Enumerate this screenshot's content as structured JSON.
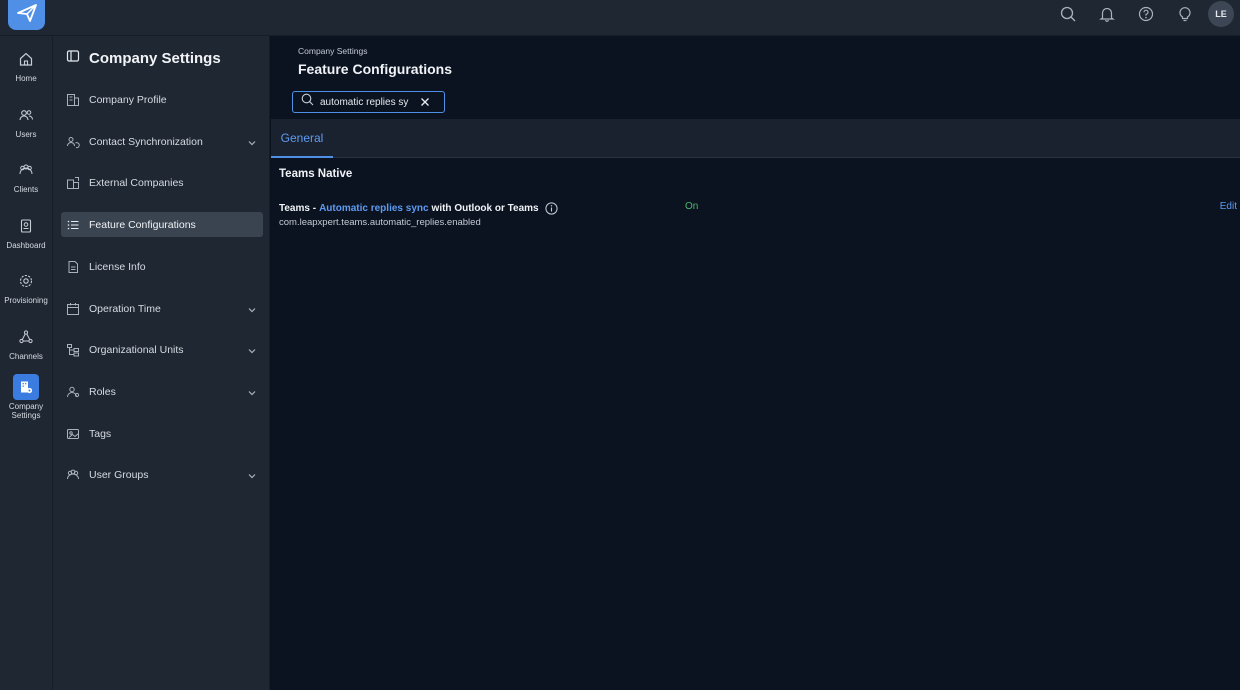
{
  "header": {
    "logo_icon": "paper-plane-icon",
    "icons": [
      "search-icon",
      "bell-icon",
      "help-icon",
      "lightbulb-icon"
    ],
    "avatar_initials": "LE"
  },
  "nav": {
    "items": [
      {
        "label": "Home",
        "icon": "home-icon"
      },
      {
        "label": "Users",
        "icon": "users-icon"
      },
      {
        "label": "Clients",
        "icon": "clients-icon"
      },
      {
        "label": "Dashboard",
        "icon": "dashboard-icon"
      },
      {
        "label": "Provisioning",
        "icon": "gear-icon"
      },
      {
        "label": "Channels",
        "icon": "channels-icon"
      },
      {
        "label": "Company Settings",
        "icon": "company-settings-icon"
      }
    ],
    "active": "Company Settings"
  },
  "sidepanel": {
    "title": "Company Settings",
    "items": [
      {
        "label": "Company Profile",
        "expandable": false
      },
      {
        "label": "Contact Synchronization",
        "expandable": true
      },
      {
        "label": "External Companies",
        "expandable": false
      },
      {
        "label": "Feature Configurations",
        "expandable": false,
        "active": true
      },
      {
        "label": "License Info",
        "expandable": false
      },
      {
        "label": "Operation Time",
        "expandable": true
      },
      {
        "label": "Organizational Units",
        "expandable": true
      },
      {
        "label": "Roles",
        "expandable": true
      },
      {
        "label": "Tags",
        "expandable": false
      },
      {
        "label": "User Groups",
        "expandable": true
      }
    ]
  },
  "main": {
    "breadcrumb": "Company Settings",
    "title": "Feature Configurations",
    "search_value": "automatic replies sy",
    "tabs": [
      {
        "label": "General",
        "active": true
      }
    ],
    "section": "Teams Native",
    "row": {
      "prefix": "Teams -",
      "highlight": "Automatic replies sync",
      "suffix": "with Outlook or Teams",
      "key": "com.leapxpert.teams.automatic_replies.enabled",
      "status": "On",
      "action": "Edit"
    }
  },
  "colors": {
    "accent": "#4f8fe6",
    "status_on": "#4cb86a",
    "background": "#0b1321",
    "panel": "#1f2733"
  }
}
